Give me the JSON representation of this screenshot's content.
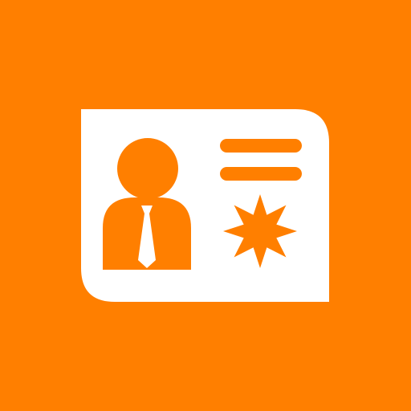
{
  "icon": {
    "name": "id-card-icon",
    "colors": {
      "background": "#FF7F00",
      "card": "#FFFFFF",
      "accent": "#FF7F00"
    },
    "elements": {
      "person": "person-icon",
      "tie": "tie-icon",
      "lines": "text-lines-icon",
      "badge": "star-badge-icon"
    }
  }
}
